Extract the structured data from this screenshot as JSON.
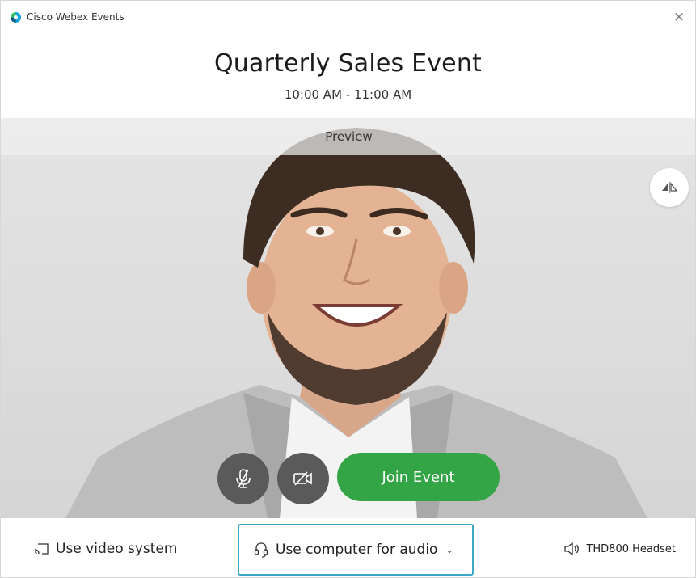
{
  "window": {
    "app_title": "Cisco Webex Events",
    "close_glyph": "×"
  },
  "header": {
    "title": "Quarterly Sales Event",
    "time": "10:00 AM - 11:00 AM"
  },
  "video": {
    "preview_label": "Preview"
  },
  "controls": {
    "join_label": "Join Event",
    "mute_icon": "microphone-muted-icon",
    "video_icon": "camera-off-icon",
    "flip_icon": "flip-mirror-icon"
  },
  "bottom": {
    "video_system_label": "Use video system",
    "audio_label": "Use computer for audio",
    "speaker_label": "THD800 Headset"
  },
  "colors": {
    "join_button": "#33a546",
    "control_buttons": "#5a5a5a",
    "audio_focus_border": "#3ca9c9"
  }
}
